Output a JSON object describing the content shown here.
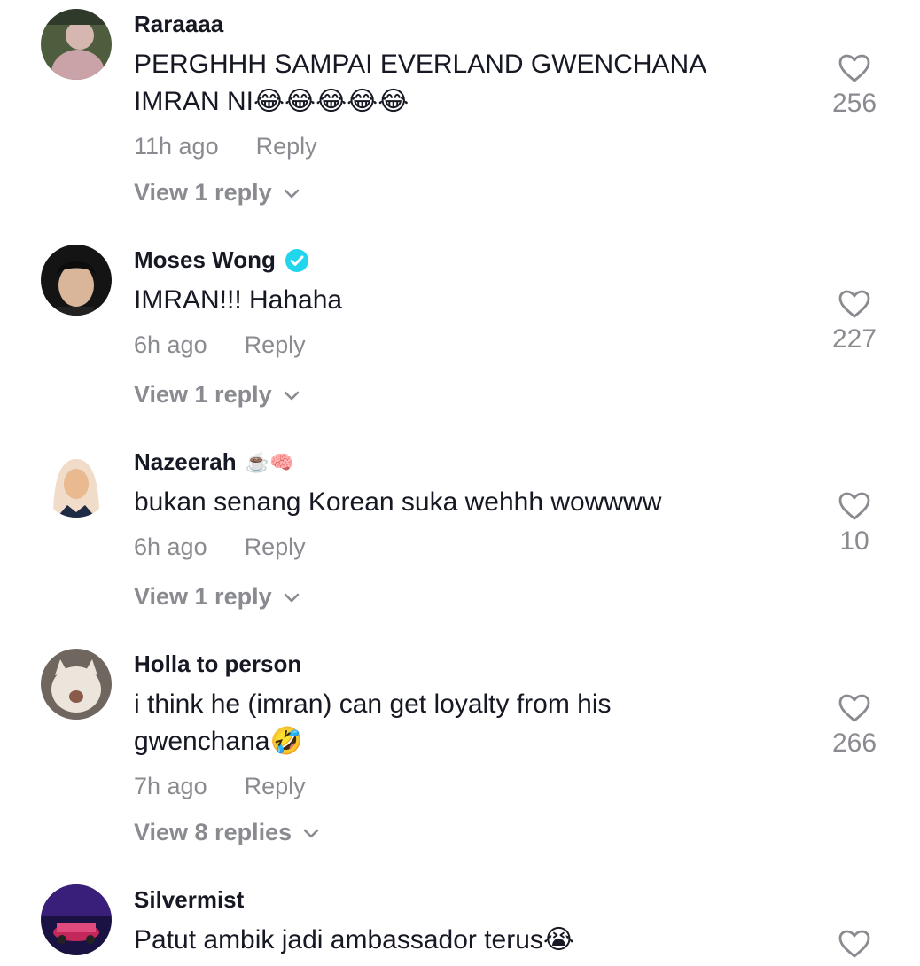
{
  "comments": [
    {
      "username": "Raraaaa",
      "username_emoji": "",
      "verified": false,
      "text": "PERGHHH SAMPAI EVERLAND GWENCHANA IMRAN NI😂😂😂😂😂",
      "time": "11h ago",
      "reply_label": "Reply",
      "view_replies": "View 1 reply",
      "likes": "256",
      "avatar_colors": [
        "#c9a3a8",
        "#5e6b4a"
      ]
    },
    {
      "username": "Moses Wong",
      "username_emoji": "",
      "verified": true,
      "text": "IMRAN!!! Hahaha",
      "time": "6h ago",
      "reply_label": "Reply",
      "view_replies": "View 1 reply",
      "likes": "227",
      "avatar_colors": [
        "#1a1a1a",
        "#d9b59a"
      ]
    },
    {
      "username": "Nazeerah",
      "username_emoji": "☕️🧠",
      "verified": false,
      "text": "bukan senang Korean suka wehhh wowwww",
      "time": "6h ago",
      "reply_label": "Reply",
      "view_replies": "View 1 reply",
      "likes": "10",
      "avatar_colors": [
        "#f0dcc8",
        "#1f2a44"
      ]
    },
    {
      "username": "Holla to person",
      "username_emoji": "",
      "verified": false,
      "text": "i think he (imran) can get loyalty from his gwenchana🤣",
      "time": "7h ago",
      "reply_label": "Reply",
      "view_replies": "View 8 replies",
      "likes": "266",
      "avatar_colors": [
        "#d8cfc4",
        "#7d6e60"
      ]
    },
    {
      "username": "Silvermist",
      "username_emoji": "",
      "verified": false,
      "text": "Patut ambik jadi ambassador terus😭",
      "time": "",
      "reply_label": "",
      "view_replies": "",
      "likes": "",
      "avatar_colors": [
        "#2a1a5e",
        "#c2285a"
      ]
    }
  ],
  "colors": {
    "text_primary": "#161823",
    "text_secondary": "#8a8b91",
    "verified_badge": "#20d5ec",
    "heart_outline": "#8a8b91"
  }
}
